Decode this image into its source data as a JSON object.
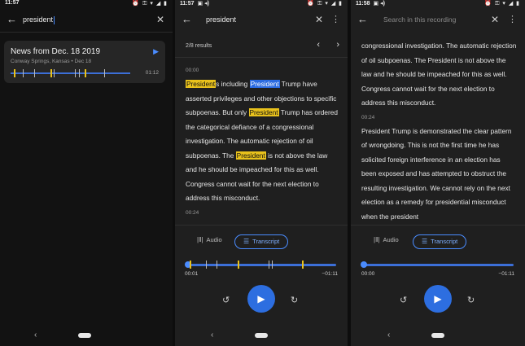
{
  "search_query": "president",
  "phones": [
    {
      "status_time": "11:57",
      "status_icons": "⏰ ⚿ ▾ ◢ ▮",
      "back_icon": "back-arrow-icon",
      "close_icon": "close-icon",
      "recording": {
        "title": "News from Dec. 18 2019",
        "location_date": "Conway Springs, Kansas • Dec 18",
        "duration": "01:12"
      },
      "mini_markers": [
        {
          "pos": 0.03,
          "hit": true
        },
        {
          "pos": 0.1,
          "hit": false
        },
        {
          "pos": 0.2,
          "hit": false
        },
        {
          "pos": 0.33,
          "hit": true
        },
        {
          "pos": 0.36,
          "hit": false
        },
        {
          "pos": 0.54,
          "hit": false
        },
        {
          "pos": 0.57,
          "hit": false
        },
        {
          "pos": 0.62,
          "hit": true
        },
        {
          "pos": 0.78,
          "hit": false
        }
      ]
    },
    {
      "status_time": "11:57",
      "status_extra": "▣ ◂)",
      "status_icons": "⏰ ⚿ ▾ ◢ ▮",
      "results": "2/8 results",
      "timestamp_1": "00:00",
      "timestamp_2": "00:24",
      "tab_audio": "Audio",
      "tab_transcript": "Transcript",
      "time_start": "00:01",
      "time_end": "−01:11",
      "markers": [
        {
          "pos": 0.02,
          "hit": true
        },
        {
          "pos": 0.13,
          "hit": false
        },
        {
          "pos": 0.2,
          "hit": false
        },
        {
          "pos": 0.34,
          "hit": true
        },
        {
          "pos": 0.55,
          "hit": false
        },
        {
          "pos": 0.57,
          "hit": false
        },
        {
          "pos": 0.77,
          "hit": true
        }
      ]
    },
    {
      "status_time": "11:58",
      "status_extra": "▣ ◂)",
      "status_icons": "⏰ ⚿ ▾ ◢ ▮",
      "search_placeholder": "Search in this recording",
      "text_a": "congressional investigation. The automatic rejection of oil subpoenas. The President is not above the law and he should be impeached for this as well. Congress cannot wait for the next election to address this misconduct.",
      "timestamp": "00:24",
      "text_b": "President Trump is demonstrated the clear pattern of wrongdoing. This is not the first time he has solicited foreign interference in an election has been exposed and has attempted to obstruct the resulting investigation. We cannot rely on the next election as a remedy for presidential misconduct when the president",
      "tab_audio": "Audio",
      "tab_transcript": "Transcript",
      "time_start": "00:00",
      "time_end": "−01:11"
    }
  ],
  "transcript_p2": {
    "w1": "President",
    "t1": "s including ",
    "w2": "President",
    "t2": " Trump have asserted privileges and other objections to specific subpoenas. But only ",
    "w3": "President",
    "t3": " Trump has ordered the categorical defiance of a congressional investigation. The automatic rejection of oil subpoenas. The ",
    "w4": "President",
    "t4": " is not above the law and he should be impeached for this as well. Congress cannot wait for the next election to address this misconduct."
  },
  "icons": {
    "back": "←",
    "close": "✕",
    "kebab": "⋮",
    "play_small": "▶",
    "prev": "‹",
    "next": "›",
    "audio": "|‖|",
    "transcript": "☰",
    "rewind": "↺",
    "forward": "↻",
    "play": "▶",
    "nav_back": "‹"
  },
  "colors": {
    "accent": "#4a8cff",
    "highlight": "#e9c21c",
    "current_highlight": "#2a6ae0"
  }
}
